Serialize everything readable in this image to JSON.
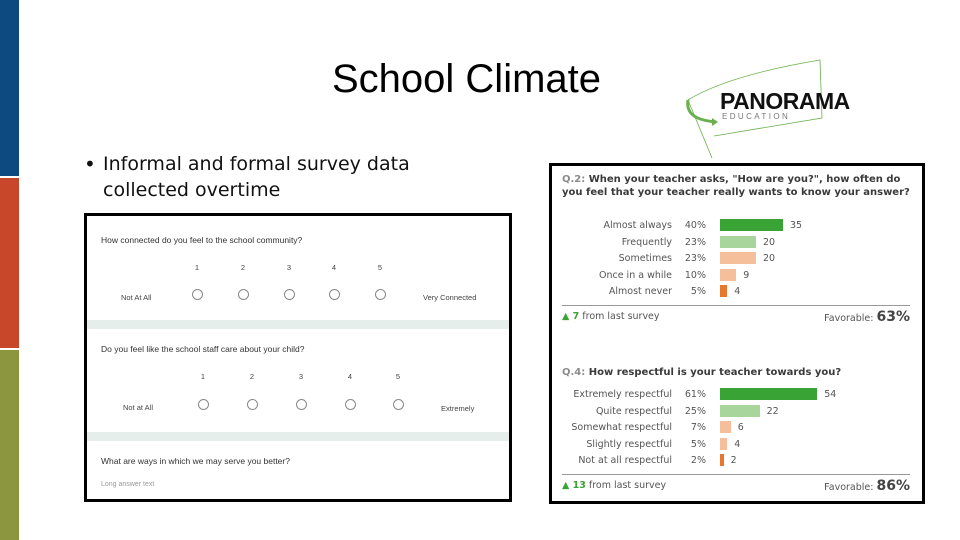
{
  "slide": {
    "title": "School Climate",
    "bullet": "Informal and formal survey data collected overtime",
    "bullet_glyph": "•",
    "stripe_colors": [
      "#0d4a80",
      "#c8462a",
      "#8b963f"
    ]
  },
  "logo": {
    "brand": "PANORAMA",
    "sub": "EDUCATION",
    "accent": "#6ab04c"
  },
  "form": {
    "questions": [
      {
        "text": "How connected do you feel to the school community?",
        "scale": [
          "1",
          "2",
          "3",
          "4",
          "5"
        ],
        "low_label": "Not At All",
        "high_label": "Very Connected"
      },
      {
        "text": "Do you feel like the school staff care about your child?",
        "scale": [
          "1",
          "2",
          "3",
          "4",
          "5"
        ],
        "low_label": "Not at All",
        "high_label": "Extremely"
      },
      {
        "text": "What are ways in which we may serve you better?",
        "placeholder": "Long answer text"
      }
    ]
  },
  "results": {
    "colors": {
      "strong_fav": "#3aa335",
      "fav": "#a8d59b",
      "neutral": "#f4bf9a",
      "unfav": "#e8772e",
      "delta": "#3aa335"
    },
    "panels": [
      {
        "qnum": "Q.2:",
        "question": "When your teacher asks, \"How are you?\", how often do you feel that your teacher really wants to know your answer?",
        "rows": [
          {
            "label": "Almost always",
            "pct": "40%",
            "count": 35,
            "tone": "strong_fav"
          },
          {
            "label": "Frequently",
            "pct": "23%",
            "count": 20,
            "tone": "fav"
          },
          {
            "label": "Sometimes",
            "pct": "23%",
            "count": 20,
            "tone": "neutral"
          },
          {
            "label": "Once in a while",
            "pct": "10%",
            "count": 9,
            "tone": "neutral"
          },
          {
            "label": "Almost never",
            "pct": "5%",
            "count": 4,
            "tone": "unfav"
          }
        ],
        "delta_arrow": "▲",
        "delta": "7",
        "delta_text": "from last survey",
        "favorable_label": "Favorable:",
        "favorable": "63%"
      },
      {
        "qnum": "Q.4:",
        "question": "How respectful is your teacher towards you?",
        "rows": [
          {
            "label": "Extremely respectful",
            "pct": "61%",
            "count": 54,
            "tone": "strong_fav"
          },
          {
            "label": "Quite respectful",
            "pct": "25%",
            "count": 22,
            "tone": "fav"
          },
          {
            "label": "Somewhat respectful",
            "pct": "7%",
            "count": 6,
            "tone": "neutral"
          },
          {
            "label": "Slightly respectful",
            "pct": "5%",
            "count": 4,
            "tone": "neutral"
          },
          {
            "label": "Not at all respectful",
            "pct": "2%",
            "count": 2,
            "tone": "unfav"
          }
        ],
        "delta_arrow": "▲",
        "delta": "13",
        "delta_text": "from last survey",
        "favorable_label": "Favorable:",
        "favorable": "86%"
      }
    ]
  }
}
